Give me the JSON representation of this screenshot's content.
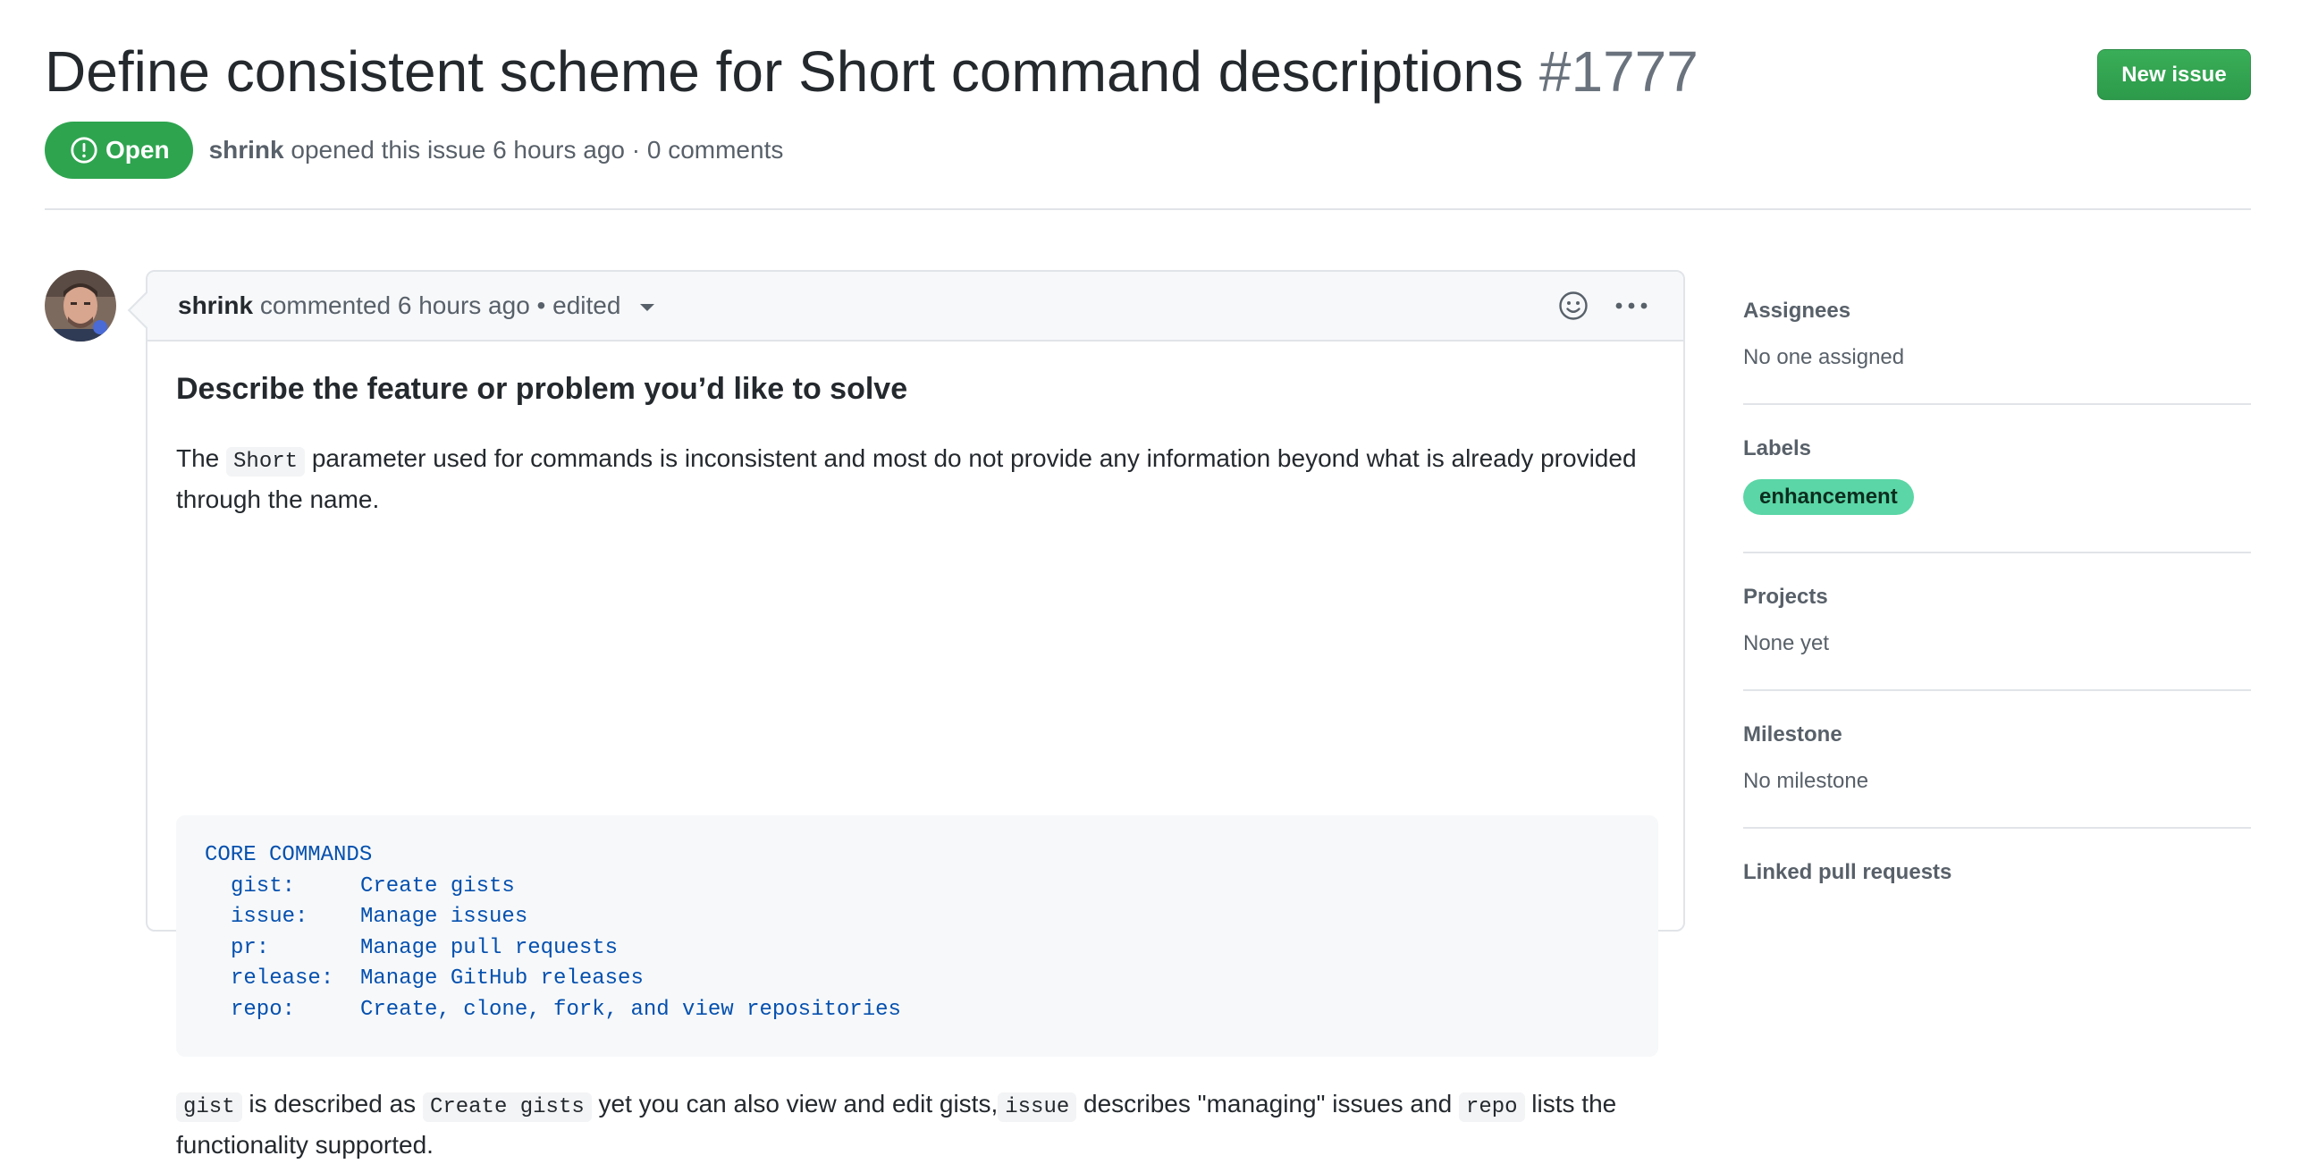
{
  "issue": {
    "title": "Define consistent scheme for Short command descriptions",
    "number": "#1777",
    "state": "Open",
    "author": "shrink",
    "meta": "opened this issue 6 hours ago · 0 comments"
  },
  "toolbar": {
    "new_issue_label": "New issue"
  },
  "comment": {
    "author": "shrink",
    "meta": "commented 6 hours ago • edited",
    "heading": "Describe the feature or problem you’d like to solve",
    "para1": {
      "pre": "The ",
      "code": "Short",
      "post": " parameter used for commands is inconsistent and most do not provide any information beyond what is already provided through the name."
    },
    "code_block": {
      "title": "CORE COMMANDS",
      "rows": [
        {
          "cmd": "gist:",
          "desc": "Create gists"
        },
        {
          "cmd": "issue:",
          "desc": "Manage issues"
        },
        {
          "cmd": "pr:",
          "desc": "Manage pull requests"
        },
        {
          "cmd": "release:",
          "desc": "Manage GitHub releases"
        },
        {
          "cmd": "repo:",
          "desc": "Create, clone, fork, and view repositories"
        }
      ]
    },
    "para2": {
      "code1": "gist",
      "t1": " is described as ",
      "code2": "Create gists",
      "t2": " yet you can also view and edit gists,",
      "code3": "issue",
      "t3": " describes \"managing\" issues and ",
      "code4": "repo",
      "t4": " lists the functionality supported."
    }
  },
  "sidebar": {
    "assignees": {
      "heading": "Assignees",
      "value": "No one assigned"
    },
    "labels": {
      "heading": "Labels",
      "items": [
        "enhancement"
      ]
    },
    "projects": {
      "heading": "Projects",
      "value": "None yet"
    },
    "milestone": {
      "heading": "Milestone",
      "value": "No milestone"
    },
    "linked_prs": {
      "heading": "Linked pull requests"
    }
  },
  "colors": {
    "open_green": "#2ea44f",
    "label_enhancement": "#5bd6a6",
    "code_blue": "#0550ae"
  },
  "icons": [
    "issue-opened-icon",
    "smiley-icon",
    "kebab-horizontal-icon",
    "caret-down-icon",
    "avatar"
  ]
}
